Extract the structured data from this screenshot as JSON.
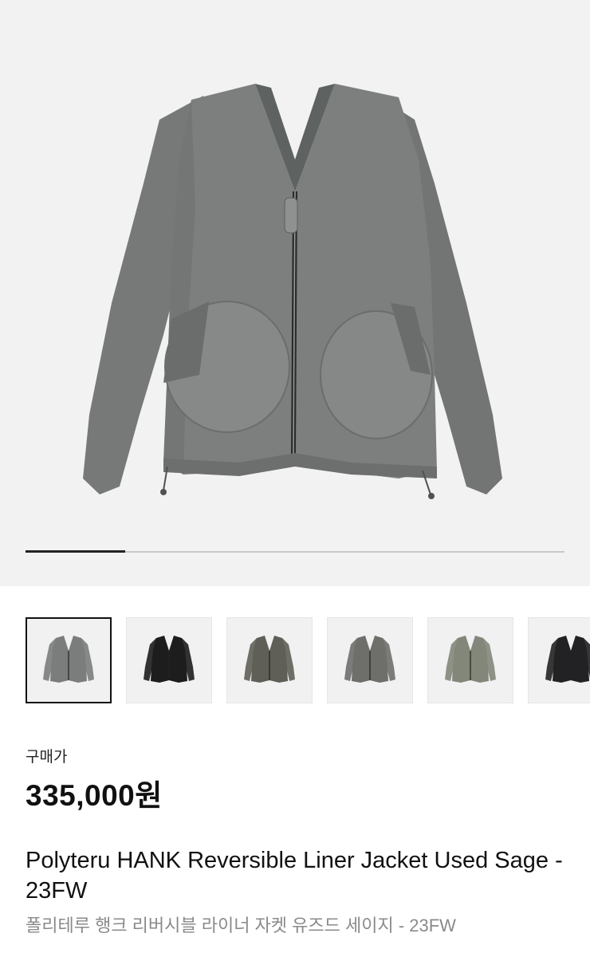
{
  "product": {
    "price_label": "구매가",
    "price": "335,000원",
    "title": "Polyteru HANK Reversible Liner Jacket Used Sage - 23FW",
    "subtitle": "폴리테루 행크 리버시블 라이너 자켓 유즈드 세이지 - 23FW"
  },
  "gallery": {
    "progress": 0.185,
    "selected_index": 0,
    "thumbnails": [
      {
        "name": "thumb-used-sage-front",
        "color": "#7a7d7c"
      },
      {
        "name": "thumb-black-front",
        "color": "#1d1d1d"
      },
      {
        "name": "thumb-olive-grey-front",
        "color": "#5f5f58"
      },
      {
        "name": "thumb-grey-front",
        "color": "#6e6e6b"
      },
      {
        "name": "thumb-sage-quilted-front",
        "color": "#83877a"
      },
      {
        "name": "thumb-black-quilted-front",
        "color": "#222224"
      }
    ]
  },
  "colors": {
    "hero_background": "#f2f2f2",
    "jacket_main": "#7b7e7d",
    "progress_track": "#c9c9c9",
    "progress_fill": "#222222",
    "subtitle_text": "#8a8a8a"
  },
  "icons": [
    "jacket-image"
  ]
}
